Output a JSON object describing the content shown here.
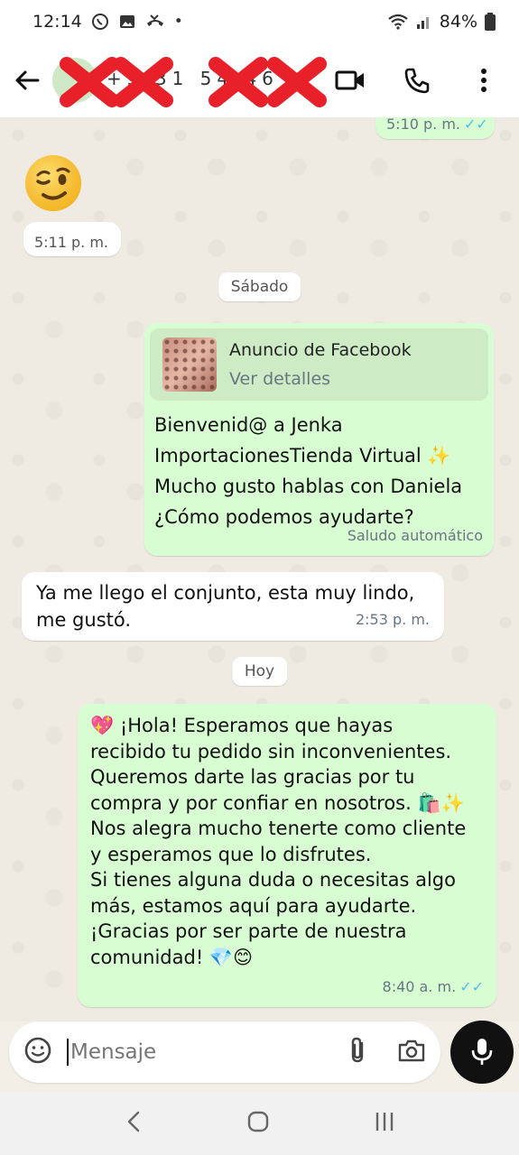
{
  "status_bar": {
    "time": "12:14",
    "battery": "84%"
  },
  "header": {
    "contact_name": "+5 31 54 46",
    "icons": [
      "back-arrow-icon",
      "video-call-icon",
      "phone-icon",
      "more-vert-icon"
    ]
  },
  "messages": {
    "top_time": "5:10 p. m.",
    "wink_time": "5:11 p. m.",
    "day_sat": "Sábado",
    "ad_title": "Anuncio de Facebook",
    "ad_sub": "Ver detalles",
    "welcome_line1": "Bienvenid@ a Jenka",
    "welcome_line2": "ImportacionesTienda Virtual ✨",
    "welcome_line3": "Mucho gusto hablas con Daniela",
    "welcome_line4": "¿Cómo podemos ayudarte?",
    "welcome_footer": "Saludo automático",
    "reply_line1": "Ya me llego el conjunto, esta muy lindo,",
    "reply_line2": "me gustó.",
    "reply_time": "2:53 p. m.",
    "day_today": "Hoy",
    "thanks_lines": [
      "💖 ¡Hola! Esperamos que hayas",
      "recibido tu pedido sin inconvenientes.",
      "Queremos darte las gracias por tu",
      "compra y por confiar en nosotros. 🛍️✨",
      "Nos alegra mucho tenerte como cliente",
      "y esperamos que lo disfrutes.",
      "Si tienes alguna duda o necesitas algo",
      "más, estamos aquí para ayudarte.",
      "¡Gracias por ser parte de nuestra",
      "comunidad! 💎😊"
    ],
    "thanks_time": "8:40 a. m."
  },
  "input": {
    "placeholder": "Mensaje"
  },
  "colors": {
    "outgoing": "#d9fdd3",
    "incoming": "#ffffff",
    "read_ticks": "#53bdeb",
    "redaction": "#e8202a"
  }
}
